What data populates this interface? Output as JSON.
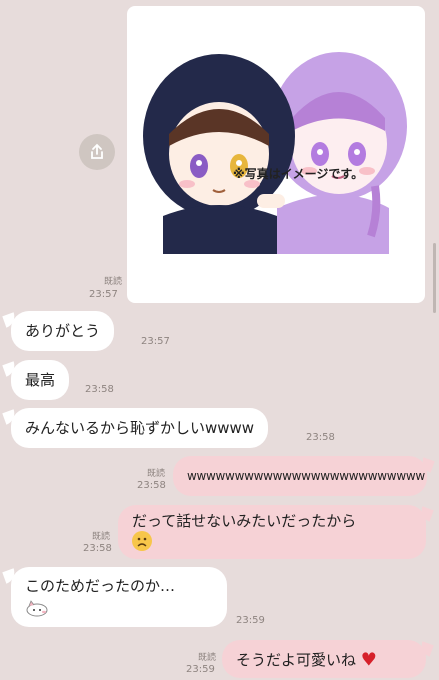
{
  "chat": {
    "photo": {
      "overlay_caption": "※写真はイメージです。",
      "read_label": "既読",
      "time": "23:57"
    },
    "messages": [
      {
        "side": "in",
        "text": "ありがとう",
        "time": "23:57"
      },
      {
        "side": "in",
        "text": "最高",
        "time": "23:58"
      },
      {
        "side": "in",
        "text": "みんないるから恥ずかしいwwww",
        "time": "23:58"
      },
      {
        "side": "out",
        "text": "wwwwwwwwwwwwwwwwwwwwwwwww",
        "read": "既読",
        "time": "23:58"
      },
      {
        "side": "out",
        "text": "だって話せないみたいだったから",
        "read": "既読",
        "time": "23:58",
        "emoji": "sad-face"
      },
      {
        "side": "in",
        "text": "このためだったのか…",
        "time": "23:59",
        "sticker": "cat-face"
      },
      {
        "side": "out",
        "text": "そうだよ可愛いね",
        "read": "既読",
        "time": "23:59",
        "emoji": "heart"
      }
    ]
  },
  "icons": {
    "share": "share-icon",
    "sad": "sad-face-icon",
    "heart": "heart-icon",
    "cat": "cat-sticker-icon"
  },
  "colors": {
    "background": "#e7dcdb",
    "incoming": "#ffffff",
    "outgoing": "#f6d2d6",
    "hood_left": "#23294a",
    "hood_right": "#c6a2e6"
  }
}
